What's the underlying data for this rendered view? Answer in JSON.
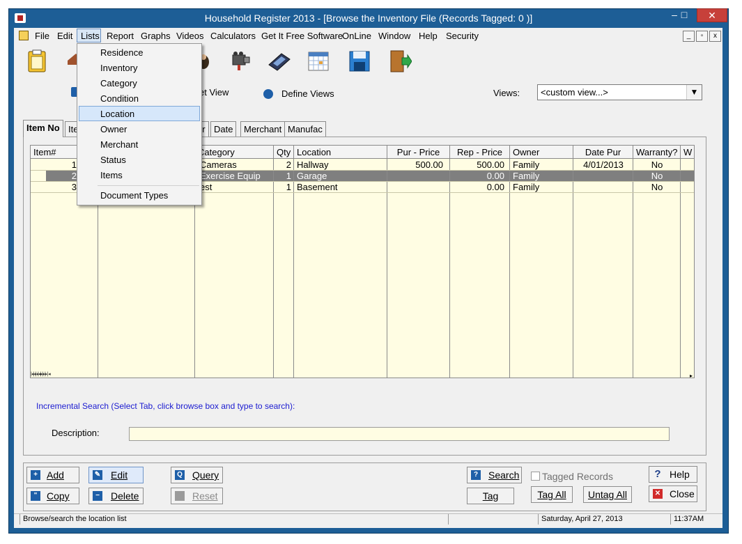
{
  "window": {
    "title": "Household Register 2013 - [Browse the Inventory File  (Records Tagged:  0 )]",
    "caption_min": "–",
    "caption_max": "□",
    "caption_close": "✕"
  },
  "menubar": {
    "items": [
      "File",
      "Edit",
      "Lists",
      "Report",
      "Graphs",
      "Videos",
      "Calculators",
      "Get It Free Software",
      "OnLine",
      "Window",
      "Help",
      "Security"
    ],
    "mdi_buttons": [
      "_",
      "▫",
      "x"
    ]
  },
  "lists_menu": {
    "items": [
      "Residence",
      "Inventory",
      "Category",
      "Condition",
      "Location",
      "Owner",
      "Merchant",
      "Status",
      "Items",
      "Document Types"
    ],
    "highlighted": "Location"
  },
  "toolbar": {
    "icons": [
      "clipboard-icon",
      "house-icon",
      "person-icon",
      "video-camera-icon",
      "calculator-icon",
      "calendar-icon",
      "save-disk-icon",
      "exit-door-icon"
    ]
  },
  "views_row": {
    "set_view_label": "et View",
    "define_views_label": "Define Views",
    "views_label": "Views:",
    "views_value": "<custom view...>"
  },
  "tabs": [
    "Item No",
    "Ite",
    "er",
    "Date",
    "Merchant",
    "Manufac"
  ],
  "grid": {
    "columns": [
      "Item#",
      "Category",
      "Qty",
      "Location",
      "Pur - Price",
      "Rep - Price",
      "Owner",
      "Date Pur",
      "Warranty?",
      "W"
    ],
    "rows": [
      {
        "item": "1",
        "category": "Cameras",
        "qty": "2",
        "location": "Hallway",
        "pur_price": "500.00",
        "rep_price": "500.00",
        "owner": "Family",
        "date_pur": "4/01/2013",
        "warranty": "No"
      },
      {
        "item": "2",
        "category": "Exercise Equip",
        "qty": "1",
        "location": "Garage",
        "pur_price": "",
        "rep_price": "0.00",
        "owner": "Family",
        "date_pur": "",
        "warranty": "No"
      },
      {
        "item": "3",
        "category": "est",
        "qty": "1",
        "location": "Basement",
        "pur_price": "",
        "rep_price": "0.00",
        "owner": "Family",
        "date_pur": "",
        "warranty": "No"
      }
    ],
    "selected_row": 1
  },
  "search": {
    "incremental_label": "Incremental Search (Select Tab, click browse box and type to search):",
    "description_label": "Description:",
    "description_value": ""
  },
  "buttons": {
    "add": "Add",
    "copy": "Copy",
    "edit": "Edit",
    "delete": "Delete",
    "query": "Query",
    "reset": "Reset",
    "search": "Search",
    "tag": "Tag",
    "tagged_records": "Tagged Records",
    "tag_all": "Tag All",
    "untag_all": "Untag All",
    "help": "Help",
    "close": "Close"
  },
  "statusbar": {
    "message": "Browse/search the location list",
    "date": "Saturday, April 27, 2013",
    "time": "11:37AM"
  },
  "colors": {
    "frame": "#1d5e96",
    "grid_bg": "#fffde3",
    "selected_row": "#7f7f7f",
    "link_blue": "#1b1bd0"
  }
}
